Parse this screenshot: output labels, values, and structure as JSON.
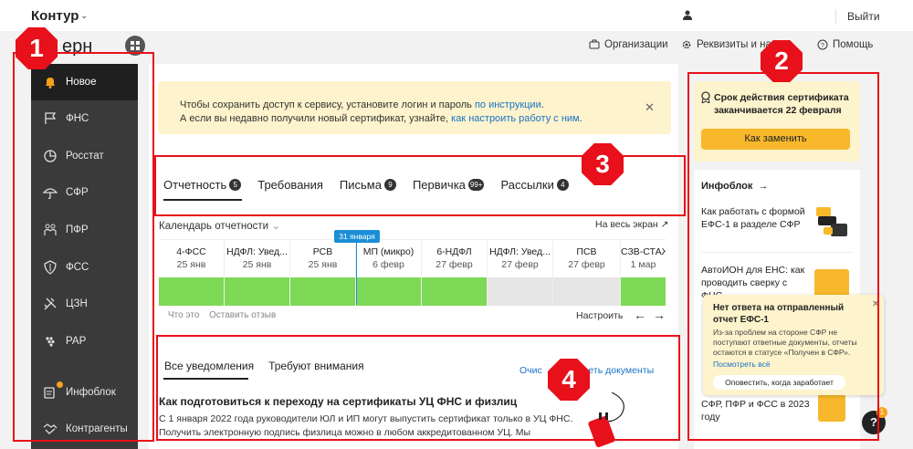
{
  "header": {
    "brand": "Контур",
    "product_fragment": "ерн",
    "logout": "Выйти",
    "nav": [
      {
        "label": "Организации",
        "icon": "briefcase-icon"
      },
      {
        "label": "Реквизиты и наст",
        "icon": "gear-icon"
      },
      {
        "label": "Помощь",
        "icon": "question-icon"
      }
    ]
  },
  "sidebar": {
    "items": [
      {
        "label": "Новое",
        "icon": "bell-icon",
        "active": true
      },
      {
        "label": "ФНС",
        "icon": "flag-icon"
      },
      {
        "label": "Росстат",
        "icon": "pie-chart-icon"
      },
      {
        "label": "СФР",
        "icon": "umbrella-icon"
      },
      {
        "label": "ПФР",
        "icon": "people-icon"
      },
      {
        "label": "ФСС",
        "icon": "shield-icon"
      },
      {
        "label": "ЦЗН",
        "icon": "tools-icon"
      },
      {
        "label": "РАР",
        "icon": "grapes-icon"
      },
      {
        "label": "Инфоблок",
        "icon": "infoblock-icon"
      },
      {
        "label": "Контрагенты",
        "icon": "handshake-icon"
      }
    ]
  },
  "banner": {
    "line1_text": "Чтобы сохранить доступ к сервису, установите логин и пароль ",
    "line1_link": "по инструкции",
    "line1_end": ".",
    "line2_text": "А если вы недавно получили новый сертификат, узнайте, ",
    "line2_link": "как настроить работу с ним",
    "line2_end": "."
  },
  "tabs": [
    {
      "label": "Отчетность",
      "badge": "5"
    },
    {
      "label": "Требования",
      "badge": ""
    },
    {
      "label": "Письма",
      "badge": "9"
    },
    {
      "label": "Первичка",
      "badge": "99+"
    },
    {
      "label": "Рассылки",
      "badge": "4"
    }
  ],
  "calendar": {
    "label": "Календарь отчетности",
    "fullscreen": "На весь экран",
    "today": "31 января",
    "columns": [
      {
        "title": "4-ФСС",
        "date": "25 янв",
        "status": "done"
      },
      {
        "title": "НДФЛ: Увед...",
        "date": "25 янв",
        "status": "done"
      },
      {
        "title": "РСВ",
        "date": "25 янв",
        "status": "done"
      },
      {
        "title": "МП (микро)",
        "date": "6 февр",
        "status": "done"
      },
      {
        "title": "6-НДФЛ",
        "date": "27 февр",
        "status": "done"
      },
      {
        "title": "НДФЛ: Увед...",
        "date": "27 февр",
        "status": "pending"
      },
      {
        "title": "ПСВ",
        "date": "27 февр",
        "status": "pending"
      },
      {
        "title": "СЗВ-СТАЖ",
        "date": "1 мар",
        "status": "done"
      }
    ],
    "footer_what": "Что это",
    "footer_feedback": "Оставить отзыв",
    "settings": "Настроить"
  },
  "notifications": {
    "tabs": [
      "Все уведомления",
      "Требуют внимания"
    ],
    "link_clear": "Очис",
    "link_docs": "треть документы",
    "title": "Как подготовиться к переходу на сертификаты УЦ ФНС и физлиц",
    "body1": "С 1 января 2022 года руководители ЮЛ и ИП могут выпустить сертификат только в УЦ ФНС.",
    "body2": "Получить электронную подпись физлица можно в любом аккредитованном УЦ. Мы"
  },
  "right": {
    "cert_title": "Срок действия сертификата заканчивается 22 февраля",
    "cert_button": "Как заменить",
    "infoblock_title": "Инфоблок",
    "articles": [
      "Как работать с формой ЕФС-1 в разделе СФР",
      "АвтоИОН для ЕНС: как проводить сверку с ФНС",
      "СФР, ПФР и ФСС в 2023 году"
    ]
  },
  "popup": {
    "title": "Нет ответа на отправленный отчет ЕФС-1",
    "body": "Из-за проблем на стороне СФР не поступают ответные документы, отчеты остаются в статусе «Получен в СФР». Повторно",
    "link": "Посмотреть всё",
    "button": "Оповестить, когда заработает"
  },
  "help": {
    "label": "?",
    "badge": "1"
  },
  "annotations": [
    "1",
    "2",
    "3",
    "4"
  ],
  "colors": {
    "accent": "#f8b82b",
    "annotation": "#e8101a",
    "done": "#7ed957",
    "pending": "#e6e6e6",
    "link": "#1a73c8"
  }
}
